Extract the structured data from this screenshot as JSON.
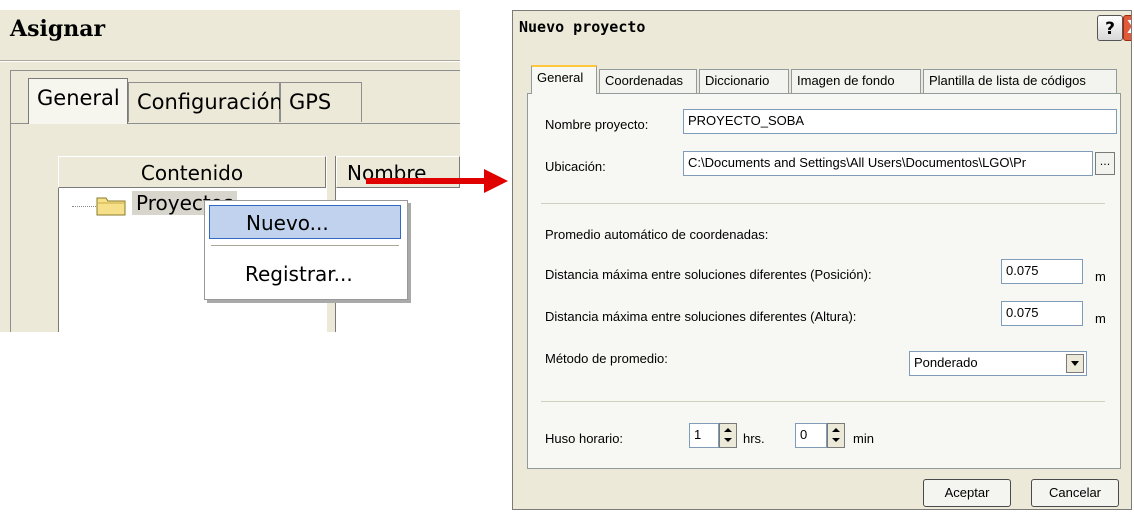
{
  "left_panel": {
    "title": "Asignar",
    "tabs": [
      "General",
      "Configuración",
      "GPS"
    ],
    "columns": {
      "contenido": "Contenido",
      "nombre": "Nombre"
    },
    "tree": {
      "item_label": "Proyectos"
    },
    "context_menu": {
      "items": [
        "Nuevo...",
        "Registrar..."
      ]
    }
  },
  "dialog": {
    "title": "Nuevo proyecto",
    "help_label": "?",
    "close_label": "X",
    "tabs": [
      "General",
      "Coordenadas",
      "Diccionario",
      "Imagen de fondo",
      "Plantilla de lista de códigos"
    ],
    "nombre_label": "Nombre proyecto:",
    "nombre_value": "PROYECTO_SOBA",
    "ubicacion_label": "Ubicación:",
    "ubicacion_value": "C:\\Documents and Settings\\All Users\\Documentos\\LGO\\Pr",
    "browse_label": "...",
    "promedio_header": "Promedio automático de coordenadas:",
    "dist_pos_label": "Distancia máxima entre soluciones diferentes (Posición):",
    "dist_pos_value": "0.075",
    "dist_alt_label": "Distancia máxima entre soluciones diferentes (Altura):",
    "dist_alt_value": "0.075",
    "unit_m": "m",
    "metodo_label": "Método de promedio:",
    "metodo_value": "Ponderado",
    "huso_label": "Huso horario:",
    "huso_hrs_value": "1",
    "hrs_label": "hrs.",
    "huso_min_value": "0",
    "min_label": "min",
    "aceptar_label": "Aceptar",
    "cancelar_label": "Cancelar"
  },
  "colors": {
    "arrow": "#e00000",
    "menu_highlight": "#c1d2ee",
    "close_button": "#e05a3a"
  }
}
